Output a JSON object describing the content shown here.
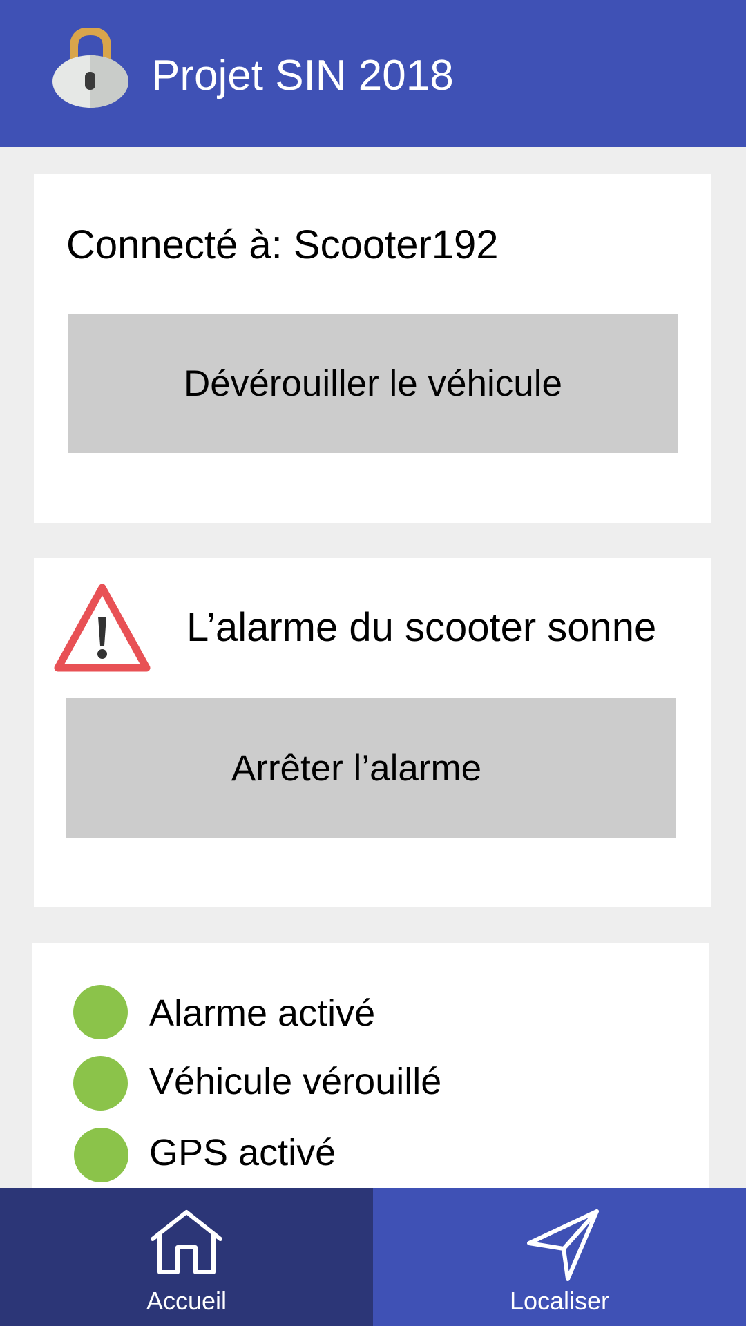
{
  "header": {
    "title": "Projet SIN 2018",
    "logo_icon": "padlock-icon",
    "background": "#3F51B5"
  },
  "connection": {
    "label": "Connecté à: Scooter192",
    "unlock_button": "Dévérouiller le véhicule"
  },
  "alarm": {
    "icon": "warning-icon",
    "message": "L’alarme du scooter sonne",
    "stop_button": "Arrêter l’alarme"
  },
  "status": {
    "indicator_color": "#8BC34A",
    "items": [
      {
        "label": "Alarme activé"
      },
      {
        "label": "Véhicule vérouillé"
      },
      {
        "label": "GPS activé"
      }
    ]
  },
  "bottom_nav": {
    "items": [
      {
        "label": "Accueil",
        "icon": "home-icon",
        "selected": true
      },
      {
        "label": "Localiser",
        "icon": "navigation-arrow-icon",
        "selected": false
      }
    ]
  },
  "colors": {
    "primary": "#3F51B5",
    "primary_dark": "#2C3677",
    "button": "#CCCCCC",
    "warning": "#E85155"
  }
}
